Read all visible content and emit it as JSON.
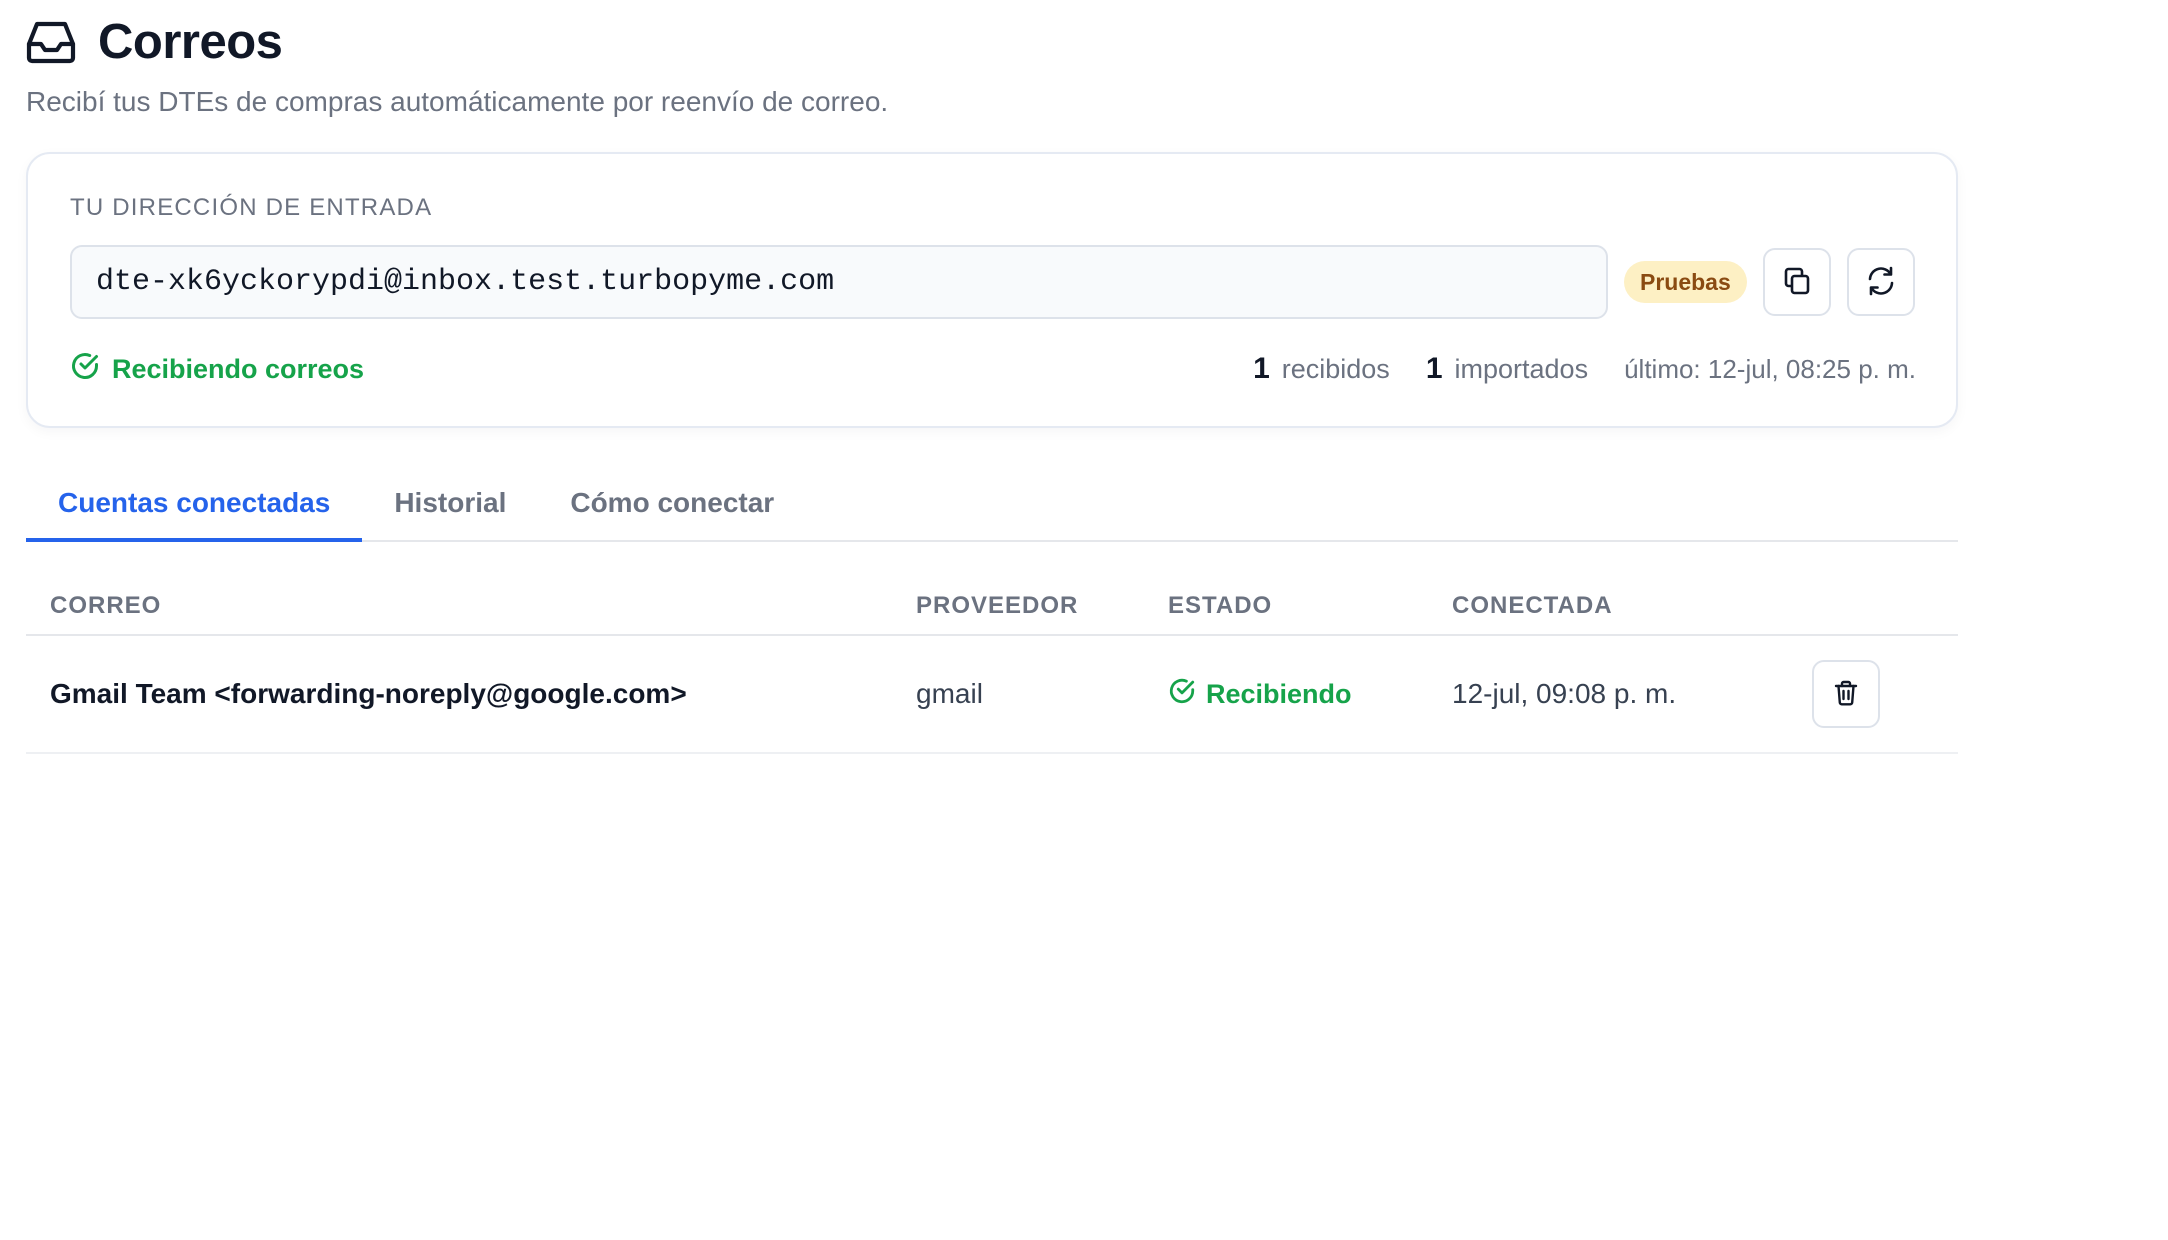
{
  "header": {
    "title": "Correos",
    "subtitle": "Recibí tus DTEs de compras automáticamente por reenvío de correo.",
    "icon": "inbox-icon"
  },
  "inbox_card": {
    "label": "TU DIRECCIÓN DE ENTRADA",
    "address": "dte-xk6yckorypdi@inbox.test.turbopyme.com",
    "env_badge": "Pruebas",
    "copy_icon": "copy-icon",
    "refresh_icon": "refresh-icon",
    "status_text": "Recibiendo correos",
    "received_count": "1",
    "received_label": "recibidos",
    "imported_count": "1",
    "imported_label": "importados",
    "last_seen": "último: 12-jul, 08:25 p. m."
  },
  "tabs": [
    {
      "label": "Cuentas conectadas",
      "active": true
    },
    {
      "label": "Historial",
      "active": false
    },
    {
      "label": "Cómo conectar",
      "active": false
    }
  ],
  "table": {
    "columns": [
      "CORREO",
      "PROVEEDOR",
      "ESTADO",
      "CONECTADA"
    ],
    "rows": [
      {
        "email": "Gmail Team <forwarding-noreply@google.com>",
        "provider": "gmail",
        "state": "Recibiendo",
        "connected": "12-jul, 09:08 p. m."
      }
    ]
  },
  "colors": {
    "accent": "#2563eb",
    "success": "#16a34a",
    "badge_bg": "#fdf0c4",
    "badge_text": "#8a4b12"
  }
}
